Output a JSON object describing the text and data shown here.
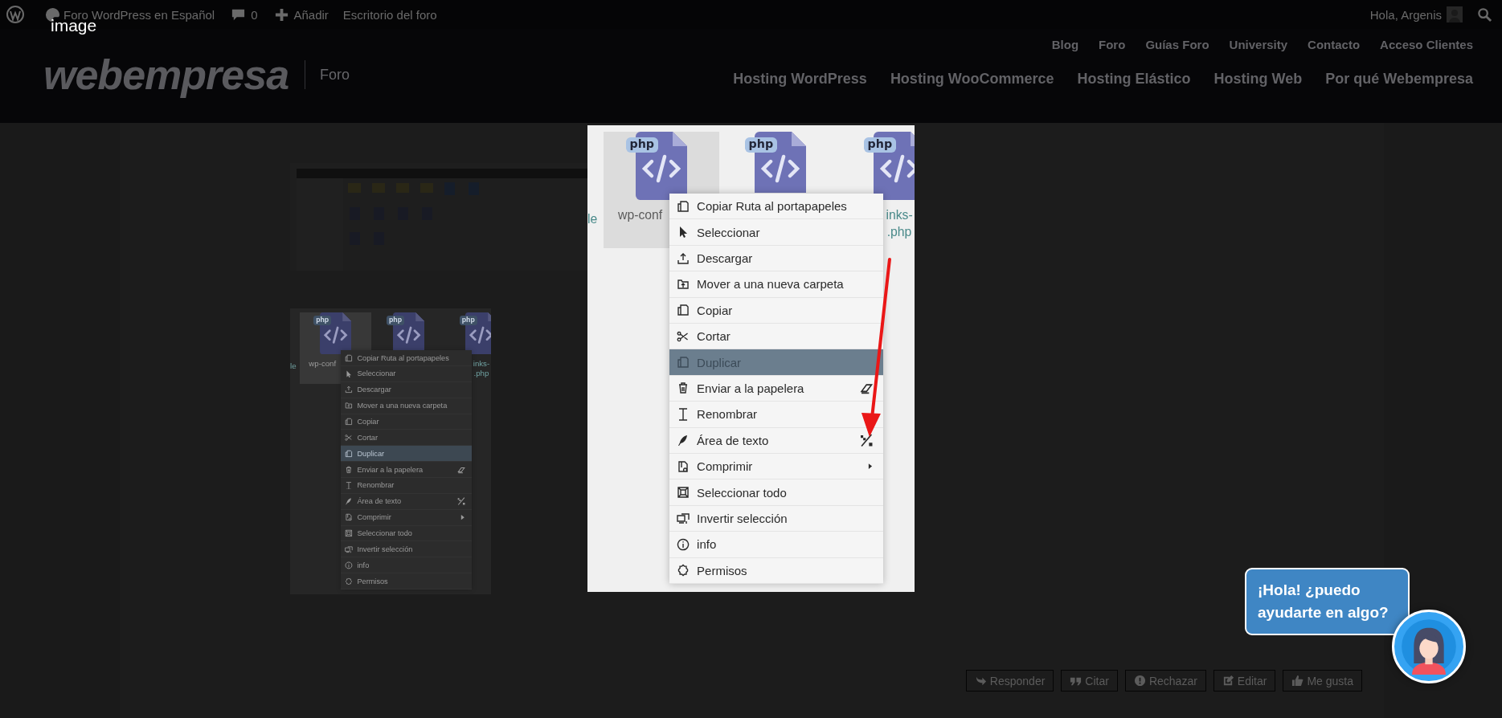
{
  "admin_bar": {
    "site_name": "Foro WordPress en Español",
    "comment_count": "0",
    "new_label": "Añadir",
    "dashboard_label": "Escritorio del foro",
    "greeting": "Hola, Argenis"
  },
  "header": {
    "logo": "webempresa",
    "section": "Foro",
    "top_links": [
      "Blog",
      "Foro",
      "Guías Foro",
      "University",
      "Contacto",
      "Acceso Clientes"
    ],
    "main_links": [
      "Hosting WordPress",
      "Hosting WooCommerce",
      "Hosting Elástico",
      "Hosting Web",
      "Por qué Webempresa"
    ]
  },
  "post": {
    "thumbnail": {
      "edge_label": "le",
      "files": [
        {
          "badge": "php",
          "label_lines": [
            "wp-conf"
          ],
          "selected": true
        },
        {
          "badge": "php",
          "selected": false
        },
        {
          "badge": "php",
          "label_lines": [
            "inks-",
            ".php"
          ],
          "selected": false
        }
      ],
      "menu": [
        {
          "label": "Copiar Ruta al portapapeles",
          "selected": false,
          "submenu": false
        },
        {
          "label": "Seleccionar",
          "selected": false,
          "submenu": false
        },
        {
          "label": "Descargar",
          "selected": false,
          "submenu": false
        },
        {
          "label": "Mover a una nueva carpeta",
          "selected": false,
          "submenu": false
        },
        {
          "label": "Copiar",
          "selected": false,
          "submenu": false
        },
        {
          "label": "Cortar",
          "selected": false,
          "submenu": false
        },
        {
          "label": "Duplicar",
          "selected": true,
          "submenu": false
        },
        {
          "label": "Enviar a la papelera",
          "selected": false,
          "submenu": false
        },
        {
          "label": "Renombrar",
          "selected": false,
          "submenu": false
        },
        {
          "label": "Área de texto",
          "selected": false,
          "submenu": false
        },
        {
          "label": "Comprimir",
          "selected": false,
          "submenu": true
        },
        {
          "label": "Seleccionar todo",
          "selected": false,
          "submenu": false
        },
        {
          "label": "Invertir selección",
          "selected": false,
          "submenu": false
        },
        {
          "label": "info",
          "selected": false,
          "submenu": false
        },
        {
          "label": "Permisos",
          "selected": false,
          "submenu": false
        }
      ]
    },
    "actions": [
      "Responder",
      "Citar",
      "Rechazar",
      "Editar",
      "Me gusta"
    ]
  },
  "lightbox": {
    "title": "image",
    "edge_label": "le",
    "files": [
      {
        "badge": "php",
        "label_lines": [
          "wp-conf"
        ],
        "selected": true
      },
      {
        "badge": "php",
        "selected": false
      },
      {
        "badge": "php",
        "label_lines": [
          "inks-",
          ".php"
        ],
        "selected": false
      }
    ],
    "menu": [
      {
        "label": "Copiar Ruta al portapapeles",
        "selected": false,
        "submenu": false
      },
      {
        "label": "Seleccionar",
        "selected": false,
        "submenu": false
      },
      {
        "label": "Descargar",
        "selected": false,
        "submenu": false
      },
      {
        "label": "Mover a una nueva carpeta",
        "selected": false,
        "submenu": false
      },
      {
        "label": "Copiar",
        "selected": false,
        "submenu": false
      },
      {
        "label": "Cortar",
        "selected": false,
        "submenu": false
      },
      {
        "label": "Duplicar",
        "selected": true,
        "submenu": false
      },
      {
        "label": "Enviar a la papelera",
        "selected": false,
        "submenu": false
      },
      {
        "label": "Renombrar",
        "selected": false,
        "submenu": false
      },
      {
        "label": "Área de texto",
        "selected": false,
        "submenu": false
      },
      {
        "label": "Comprimir",
        "selected": false,
        "submenu": true
      },
      {
        "label": "Seleccionar todo",
        "selected": false,
        "submenu": false
      },
      {
        "label": "Invertir selección",
        "selected": false,
        "submenu": false
      },
      {
        "label": "info",
        "selected": false,
        "submenu": false
      },
      {
        "label": "Permisos",
        "selected": false,
        "submenu": false
      }
    ]
  },
  "chat": {
    "message": "¡Hola! ¿puedo ayudarte en algo?"
  }
}
